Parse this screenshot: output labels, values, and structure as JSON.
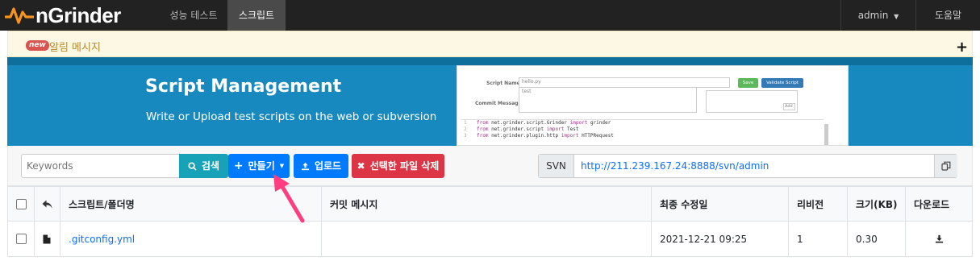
{
  "navbar": {
    "brand": "nGrinder",
    "menu": [
      {
        "label": "성능 테스트",
        "active": false
      },
      {
        "label": "스크립트",
        "active": true
      }
    ],
    "user": "admin",
    "help": "도움말"
  },
  "alert": {
    "badge": "new",
    "label": "알림 메시지",
    "expand_symbol": "+"
  },
  "banner": {
    "title": "Script Management",
    "subtitle": "Write or Upload test scripts on the web or subversion",
    "preview": {
      "script_name_label": "Script Name",
      "script_name_value": "hello.py",
      "save_label": "Save",
      "validate_label": "Validate Script",
      "commit_label": "Commit Message",
      "commit_value": "test",
      "add_label": "Add",
      "code_lines": [
        {
          "num": "1",
          "kw1": "from",
          "mid": " net.grinder.script.Grinder ",
          "kw2": "import",
          "rest": " grinder"
        },
        {
          "num": "2",
          "kw1": "from",
          "mid": " net.grinder.script ",
          "kw2": "import",
          "rest": " Test"
        },
        {
          "num": "3",
          "kw1": "from",
          "mid": " net.grinder.plugin.http ",
          "kw2": "import",
          "rest": " HTTPRequest"
        }
      ]
    }
  },
  "toolbar": {
    "search_placeholder": "Keywords",
    "search_label": "검색",
    "create_label": "만들기",
    "upload_label": "업로드",
    "delete_label": "선택한 파일 삭제",
    "svn_label": "SVN",
    "svn_url": "http://211.239.167.24:8888/svn/admin"
  },
  "table": {
    "headers": [
      "스크립트/폴더명",
      "커밋 메시지",
      "최종 수정일",
      "리비전",
      "크기(KB)",
      "다운로드"
    ],
    "rows": [
      {
        "name": "gitconfig.yml",
        "commit": "",
        "modified": "2021-12-21 09:25",
        "revision": "1",
        "size": "0.30"
      }
    ]
  },
  "colors": {
    "navbar": "#222222",
    "banner": "#1789be",
    "primary": "#007bff",
    "info": "#17a2b8",
    "danger": "#dc3545",
    "annotation_arrow": "#ff3d7f"
  }
}
